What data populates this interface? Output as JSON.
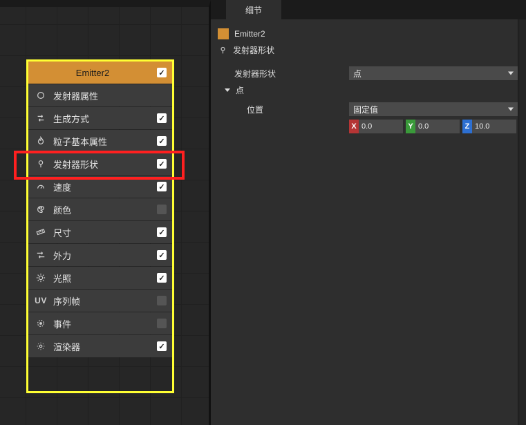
{
  "left": {
    "emitter_name": "Emitter2",
    "header_checked": true,
    "modules": [
      {
        "icon": "circle",
        "label": "发射器属性",
        "checked": null
      },
      {
        "icon": "swap",
        "label": "生成方式",
        "checked": true
      },
      {
        "icon": "flame",
        "label": "粒子基本属性",
        "checked": true
      },
      {
        "icon": "pin",
        "label": "发射器形状",
        "checked": true
      },
      {
        "icon": "gauge",
        "label": "速度",
        "checked": true
      },
      {
        "icon": "palette",
        "label": "颜色",
        "checked": false
      },
      {
        "icon": "ruler",
        "label": "尺寸",
        "checked": true
      },
      {
        "icon": "force",
        "label": "外力",
        "checked": true
      },
      {
        "icon": "sun",
        "label": "光照",
        "checked": true
      },
      {
        "icon": "uv",
        "label": "序列帧",
        "checked": false
      },
      {
        "icon": "event",
        "label": "事件",
        "checked": false
      },
      {
        "icon": "render",
        "label": "渲染器",
        "checked": true
      }
    ]
  },
  "right": {
    "tab_label": "细节",
    "object_name": "Emitter2",
    "selected_module": "发射器形状",
    "props": {
      "shape_label": "发射器形状",
      "shape_value": "点",
      "shape_expand_label": "点",
      "pos_label": "位置",
      "pos_mode": "固定值",
      "pos_x": "0.0",
      "pos_y": "0.0",
      "pos_z": "10.0"
    }
  }
}
